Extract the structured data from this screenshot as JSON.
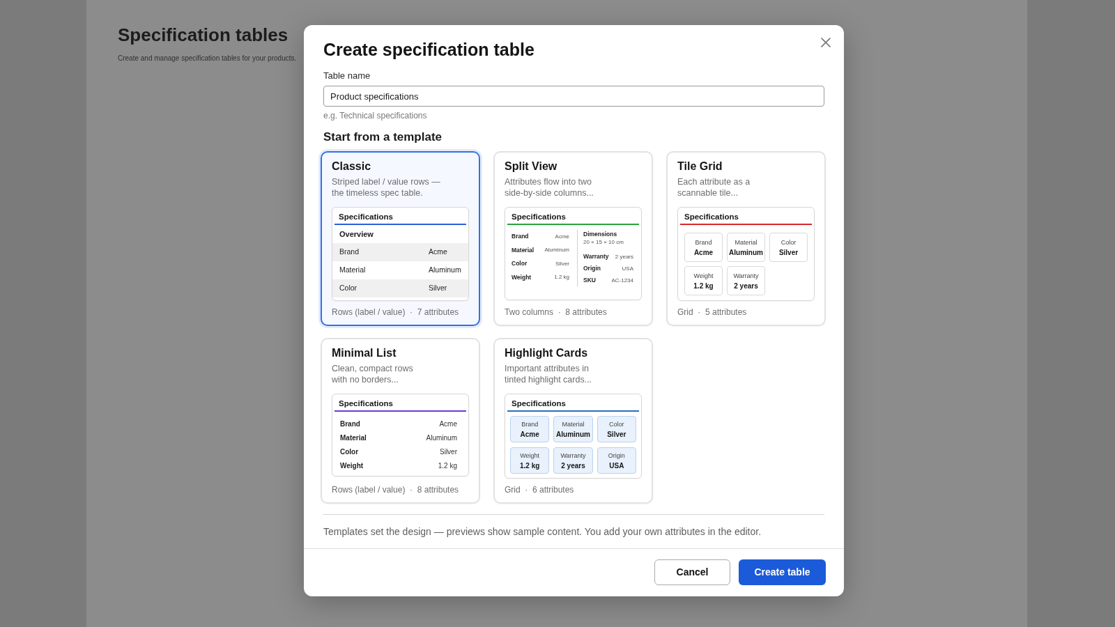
{
  "page": {
    "title": "Specification tables",
    "subtitle": "Create and manage specification tables for your products."
  },
  "dialog": {
    "title": "Create specification table",
    "table_name": {
      "label": "Table name",
      "value": "Product specifications",
      "helper_text": "e.g. Technical specifications"
    },
    "templates_heading": "Start from a template",
    "templates": [
      {
        "kind": "striped",
        "name": "Classic",
        "description": [
          "Striped label / value rows —",
          "the timeless spec table."
        ],
        "selected": true,
        "preview": {
          "title": "Specifications",
          "color": "#2d5fd6",
          "section": "Overview",
          "rows": [
            {
              "label": "Brand",
              "value": "Acme"
            },
            {
              "label": "Material",
              "value": "Aluminum"
            },
            {
              "label": "Color",
              "value": "Silver"
            }
          ]
        },
        "summary": "Rows (label / value)  ·  7 attributes"
      },
      {
        "kind": "split",
        "name": "Split View",
        "description": [
          "Attributes flow into two",
          "side-by-side columns..."
        ],
        "selected": false,
        "preview": {
          "title": "Specifications",
          "color": "#2aa33c",
          "columns": [
            [
              {
                "kind": "pair",
                "label": "Brand",
                "value": "Acme"
              },
              {
                "kind": "pair",
                "label": "Material",
                "value": "Aluminum"
              },
              {
                "kind": "pair",
                "label": "Color",
                "value": "Silver"
              },
              {
                "kind": "pair",
                "label": "Weight",
                "value": "1.2 kg"
              }
            ],
            [
              {
                "kind": "stacked",
                "label": "Dimensions",
                "value": "20 × 15 × 10 cm"
              },
              {
                "kind": "pair",
                "label": "Warranty",
                "value": "2 years"
              },
              {
                "kind": "pair",
                "label": "Origin",
                "value": "USA"
              },
              {
                "kind": "pair",
                "label": "SKU",
                "value": "AC-1234"
              }
            ]
          ]
        },
        "summary": "Two columns  ·  8 attributes"
      },
      {
        "kind": "tiles",
        "name": "Tile Grid",
        "description": [
          "Each attribute as a",
          "scannable tile..."
        ],
        "selected": false,
        "preview": {
          "title": "Specifications",
          "color": "#d8262b",
          "tiles": [
            {
              "label": "Brand",
              "value": "Acme"
            },
            {
              "label": "Material",
              "value": "Aluminum"
            },
            {
              "label": "Color",
              "value": "Silver"
            },
            {
              "label": "Weight",
              "value": "1.2 kg"
            },
            {
              "label": "Warranty",
              "value": "2 years"
            }
          ]
        },
        "summary": "Grid  ·  5 attributes"
      },
      {
        "kind": "list",
        "name": "Minimal List",
        "description": [
          "Clean, compact rows",
          "with no borders..."
        ],
        "selected": false,
        "preview": {
          "title": "Specifications",
          "color": "#6a3bd1",
          "rows": [
            {
              "label": "Brand",
              "value": "Acme"
            },
            {
              "label": "Material",
              "value": "Aluminum"
            },
            {
              "label": "Color",
              "value": "Silver"
            },
            {
              "label": "Weight",
              "value": "1.2 kg"
            }
          ]
        },
        "summary": "Rows (label / value)  ·  8 attributes"
      },
      {
        "kind": "highlight",
        "name": "Highlight Cards",
        "description": [
          "Important attributes in",
          "tinted highlight cards..."
        ],
        "selected": false,
        "preview": {
          "title": "Specifications",
          "color": "#2470c2",
          "tiles": [
            {
              "label": "Brand",
              "value": "Acme"
            },
            {
              "label": "Material",
              "value": "Aluminum"
            },
            {
              "label": "Color",
              "value": "Silver"
            },
            {
              "label": "Weight",
              "value": "1.2 kg"
            },
            {
              "label": "Warranty",
              "value": "2 years"
            },
            {
              "label": "Origin",
              "value": "USA"
            }
          ]
        },
        "summary": "Grid  ·  6 attributes"
      }
    ],
    "note": "Templates set the design — previews show sample content. You add your own attributes in the editor.",
    "buttons": [
      {
        "kind": "secondary",
        "label": "Cancel"
      },
      {
        "kind": "primary",
        "label": "Create table"
      }
    ]
  }
}
